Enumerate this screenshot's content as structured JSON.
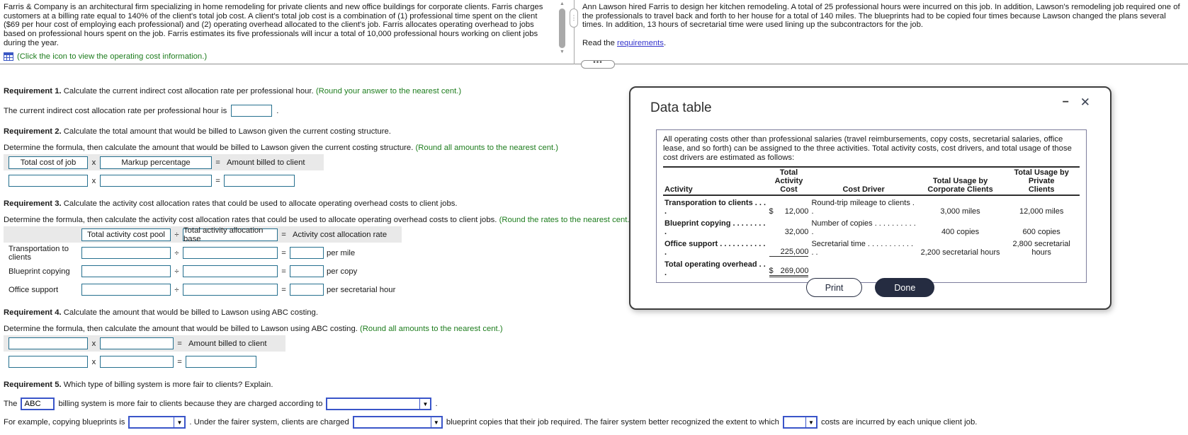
{
  "intro": {
    "left_text": "Farris & Company is an architectural firm specializing in home remodeling for private clients and new office buildings for corporate clients. Farris charges customers at a billing rate equal to 140% of the client's total job cost. A client's total job cost is a combination of (1) professional time spent on the client ($69 per hour cost of employing each professional) and (2) operating overhead allocated to the client's job. Farris allocates operating overhead to jobs based on professional hours spent on the job. Farris estimates its five professionals will incur a total of 10,000 professional hours working on client jobs during the year.",
    "click_icon_text": "(Click the icon to view the operating cost information.)",
    "right_text": "Ann Lawson hired Farris to design her kitchen remodeling. A total of 25 professional hours were incurred on this job. In addition, Lawson's remodeling job required one of the professionals to travel back and forth to her house for a total of 140 miles. The blueprints had to be copied four times because Lawson changed the plans several times. In addition, 13 hours of secretarial time were used lining up the subcontractors for the job.",
    "read_prefix": "Read the ",
    "requirements_link": "requirements",
    "read_suffix": "."
  },
  "req1": {
    "title": "Requirement 1.",
    "desc": "Calculate the current indirect cost allocation rate per professional hour.",
    "hint": "(Round your answer to the nearest cent.)",
    "line_label": "The current indirect cost allocation rate per professional hour is",
    "line_suffix": "."
  },
  "req2": {
    "title": "Requirement 2.",
    "desc": "Calculate the total amount that would be billed to Lawson given the current costing structure.",
    "sub": "Determine the formula, then calculate the amount that would be billed to Lawson given the current costing structure.",
    "hint": "(Round all amounts to the nearest cent.)",
    "operand1": "Total cost of job",
    "operator": "x",
    "operand2": "Markup percentage",
    "equals": "=",
    "result_label": "Amount billed to client"
  },
  "req3": {
    "title": "Requirement 3.",
    "desc": "Calculate the activity cost allocation rates that could be used to allocate operating overhead costs to client jobs.",
    "sub": "Determine the formula, then calculate the activity cost allocation rates that could be used to allocate operating overhead costs to client jobs.",
    "hint": "(Round the rates to the nearest cent.)",
    "col1": "Total activity cost pool",
    "operator": "÷",
    "col2": "Total activity allocation base",
    "equals": "=",
    "col3": "Activity cost allocation rate",
    "rows": [
      {
        "label": "Transportation to clients",
        "unit": "per mile"
      },
      {
        "label": "Blueprint copying",
        "unit": "per copy"
      },
      {
        "label": "Office support",
        "unit": "per secretarial hour"
      }
    ]
  },
  "req4": {
    "title": "Requirement 4.",
    "desc": "Calculate the amount that would be billed to Lawson using ABC costing.",
    "sub": "Determine the formula, then calculate the amount that would be billed to Lawson using ABC costing.",
    "hint": "(Round all amounts to the nearest cent.)",
    "operator": "x",
    "equals": "=",
    "result_label": "Amount billed to client"
  },
  "req5": {
    "title": "Requirement 5.",
    "desc": "Which type of billing system is more fair to clients? Explain.",
    "s1_pre": "The",
    "s1_answer": "ABC",
    "s1_mid": "billing system is more fair to clients because they are charged according to",
    "s1_end": ".",
    "s2_pre": "For example, copying blueprints is",
    "s2_mid1": ". Under the fairer system, clients are charged",
    "s2_mid2": "blueprint copies that their job required. The fairer system better recognized the extent to which",
    "s2_end": "costs are incurred by each unique client job."
  },
  "modal": {
    "title": "Data table",
    "intro": "All operating costs other than professional salaries (travel reimbursements, copy costs, secretarial salaries, office lease, and so forth) can be assigned to the three activities. Total activity costs, cost drivers, and total usage of those cost drivers are estimated as follows:",
    "table": {
      "headers": {
        "activity": "Activity",
        "cost": "Total\nActivity\nCost",
        "driver": "Cost Driver",
        "corporate": "Total Usage by\nCorporate Clients",
        "private": "Total Usage by Private\nClients"
      },
      "rows": [
        {
          "activity": "Transporation to clients . . . .",
          "dollar": "$",
          "cost": "12,000",
          "driver": "Round-trip mileage to clients . .",
          "corporate": "3,000 miles",
          "private": "12,000 miles"
        },
        {
          "activity": "Blueprint copying . . . . . . . . .",
          "dollar": "",
          "cost": "32,000",
          "driver": "Number of copies . . . . . . . . . . .",
          "corporate": "400 copies",
          "private": "600 copies"
        },
        {
          "activity": "Office support . . . . . . . . . . . .",
          "dollar": "",
          "cost": "225,000",
          "driver": "Secretarial time . . . . . . . . . . . . .",
          "corporate": "2,200 secretarial hours",
          "private": "2,800 secretarial hours"
        },
        {
          "activity": "Total operating overhead . . .",
          "dollar": "$",
          "cost": "269,000",
          "driver": "",
          "corporate": "",
          "private": ""
        }
      ]
    },
    "print_label": "Print",
    "done_label": "Done"
  },
  "icons": {
    "scroll_up": "▲",
    "scroll_down": "▼",
    "pane_handle": "⋮",
    "splitter_handle": "•••",
    "select_arrow": "▼",
    "minimize": "−",
    "close": "✕"
  },
  "colors": {
    "green_hint": "#1e7d1e",
    "link_blue": "#3333cc",
    "answer_box_border": "#26708f",
    "select_border": "#3a55c9",
    "formula_band": "#e9e9e9",
    "button_dark": "#252c41"
  }
}
